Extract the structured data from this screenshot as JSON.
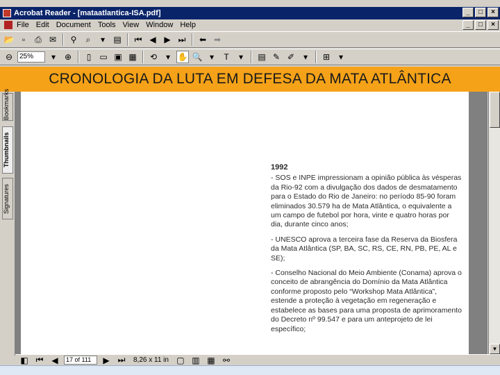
{
  "window": {
    "title": "Acrobat Reader - [mataatlantica-ISA.pdf]",
    "minimize": "_",
    "restore": "□",
    "close": "×"
  },
  "menu": [
    "File",
    "Edit",
    "Document",
    "Tools",
    "View",
    "Window",
    "Help"
  ],
  "toolbar": {
    "zoom_value": "25%"
  },
  "banner": {
    "text": "CRONOLOGIA DA LUTA EM DEFESA DA MATA ATLÂNTICA",
    "color": "#f5a219"
  },
  "nav_tabs": [
    "Bookmarks",
    "Thumbnails",
    "Signatures"
  ],
  "document": {
    "year": "1992",
    "paragraphs": [
      "- SOS e INPE impressionam a opinião pública às vésperas da Rio-92 com a divulgação dos dados de desmatamento para o Estado do Rio de Janeiro: no período 85-90 foram eliminados 30.579 ha de Mata Atlântica, o equivalente a um campo de futebol por hora, vinte e quatro horas por dia, durante cinco anos;",
      "- UNESCO aprova a terceira fase da Reserva da Biosfera da Mata Atlântica (SP, BA, SC, RS, CE, RN, PB, PE, AL e SE);",
      "- Conselho Nacional do Meio Ambiente (Conama) aprova o conceito de abrangência do Domínio da Mata Atlântica conforme proposto pelo “Workshop Mata Atlântica”, estende a proteção à vegetação em regeneração e estabelece as bases para uma proposta de aprimoramento do Decreto nº 99.547 e para um anteprojeto de lei específico;"
    ]
  },
  "status": {
    "page": "17 of 111",
    "size": "8,26 x 11 in"
  }
}
